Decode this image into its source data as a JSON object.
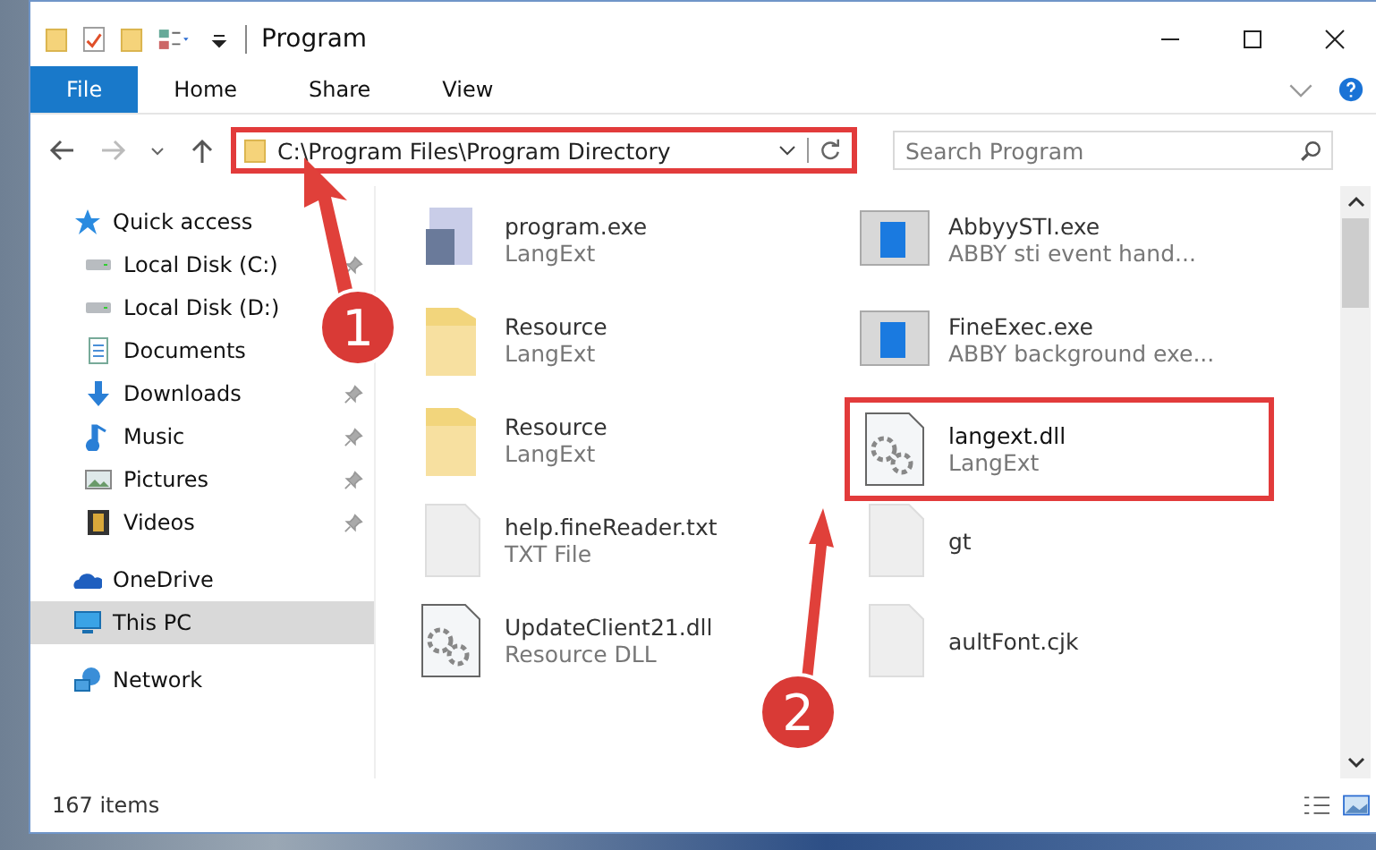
{
  "window": {
    "title": "Program"
  },
  "ribbon_tabs": [
    {
      "label": "File",
      "selected": true
    },
    {
      "label": "Home",
      "selected": false
    },
    {
      "label": "Share",
      "selected": false
    },
    {
      "label": "View",
      "selected": false
    }
  ],
  "address": {
    "value": "C:\\Program Files\\Program Directory"
  },
  "search": {
    "placeholder": "Search Program"
  },
  "sidebar": {
    "items": [
      {
        "label": "Quick access",
        "kind": "star",
        "pinned": false,
        "selected": false,
        "sub": false
      },
      {
        "label": "Local Disk (C:)",
        "kind": "disk",
        "pinned": true,
        "selected": false,
        "sub": true
      },
      {
        "label": "Local Disk (D:)",
        "kind": "disk",
        "pinned": false,
        "selected": false,
        "sub": true
      },
      {
        "label": "Documents",
        "kind": "doc",
        "pinned": false,
        "selected": false,
        "sub": true
      },
      {
        "label": "Downloads",
        "kind": "down",
        "pinned": true,
        "selected": false,
        "sub": true
      },
      {
        "label": "Music",
        "kind": "music",
        "pinned": true,
        "selected": false,
        "sub": true
      },
      {
        "label": "Pictures",
        "kind": "pic",
        "pinned": true,
        "selected": false,
        "sub": true
      },
      {
        "label": "Videos",
        "kind": "video",
        "pinned": true,
        "selected": false,
        "sub": true
      },
      {
        "label": "OneDrive",
        "kind": "cloud",
        "pinned": false,
        "selected": false,
        "sub": false
      },
      {
        "label": "This PC",
        "kind": "pc",
        "pinned": false,
        "selected": true,
        "sub": false
      },
      {
        "label": "Network",
        "kind": "net",
        "pinned": false,
        "selected": false,
        "sub": false
      }
    ]
  },
  "files": [
    {
      "name": "program.exe",
      "type": "LangExt",
      "kind": "exe",
      "highlighted": false
    },
    {
      "name": "AbbyySTI.exe",
      "type": "ABBY sti event hand...",
      "kind": "app",
      "highlighted": false
    },
    {
      "name": "Resource",
      "type": "LangExt",
      "kind": "folder",
      "highlighted": false
    },
    {
      "name": "FineExec.exe",
      "type": "ABBY background exe...",
      "kind": "app",
      "highlighted": false
    },
    {
      "name": "Resource",
      "type": "LangExt",
      "kind": "folder",
      "highlighted": false
    },
    {
      "name": "langext.dll",
      "type": "LangExt",
      "kind": "dll",
      "highlighted": true
    },
    {
      "name": "help.fineReader.txt",
      "type": "TXT File",
      "kind": "blank",
      "highlighted": false
    },
    {
      "name": "gt",
      "kind": "blank",
      "highlighted": false
    },
    {
      "name": "UpdateClient21.dll",
      "type": "Resource DLL",
      "kind": "dll",
      "highlighted": false
    },
    {
      "name": "aultFont.cjk",
      "kind": "blank",
      "highlighted": false
    }
  ],
  "callouts": [
    {
      "number": "1"
    },
    {
      "number": "2"
    }
  ],
  "status_bar": {
    "count": "167 items"
  }
}
